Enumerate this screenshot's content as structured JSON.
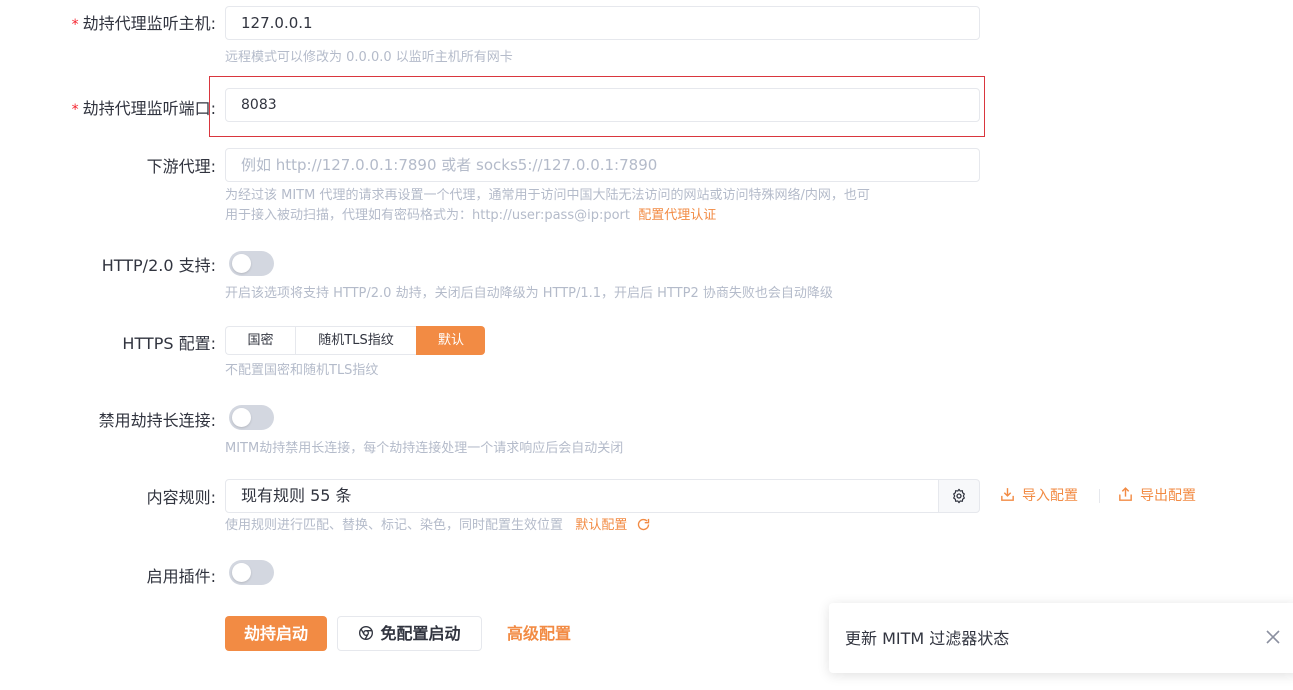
{
  "form": {
    "host": {
      "label": "劫持代理监听主机:",
      "required_mark": "*",
      "value": "127.0.0.1",
      "help": "远程模式可以修改为 0.0.0.0 以监听主机所有网卡"
    },
    "port": {
      "label": "劫持代理监听端口:",
      "required_mark": "*",
      "value": "8083"
    },
    "downstream": {
      "label": "下游代理:",
      "placeholder": "例如 http://127.0.0.1:7890 或者 socks5://127.0.0.1:7890",
      "help_line1": "为经过该 MITM 代理的请求再设置一个代理，通常用于访问中国大陆无法访问的网站或访问特殊网络/内网，也可",
      "help_line2": "用于接入被动扫描，代理如有密码格式为：http://user:pass@ip:port",
      "help_link": "配置代理认证"
    },
    "http2": {
      "label": "HTTP/2.0 支持:",
      "enabled": false,
      "help": "开启该选项将支持 HTTP/2.0 劫持，关闭后自动降级为 HTTP/1.1，开启后 HTTP2 协商失败也会自动降级"
    },
    "https": {
      "label": "HTTPS 配置:",
      "options": [
        "国密",
        "随机TLS指纹",
        "默认"
      ],
      "selected": "默认",
      "help": "不配置国密和随机TLS指纹"
    },
    "keepalive": {
      "label": "禁用劫持长连接:",
      "enabled": false,
      "help": "MITM劫持禁用长连接，每个劫持连接处理一个请求响应后会自动关闭"
    },
    "rules": {
      "label": "内容规则:",
      "value": "现有规则 55 条",
      "import_label": "导入配置",
      "export_label": "导出配置",
      "help": "使用规则进行匹配、替换、标记、染色，同时配置生效位置",
      "default_link": "默认配置"
    },
    "plugins": {
      "label": "启用插件:",
      "enabled": false
    }
  },
  "actions": {
    "start": "劫持启动",
    "no_config_start": "免配置启动",
    "advanced": "高级配置"
  },
  "notification": {
    "text": "更新 MITM 过滤器状态"
  },
  "colors": {
    "accent": "#f28b44",
    "required": "#f5222d",
    "highlight_border": "#d9363e"
  }
}
